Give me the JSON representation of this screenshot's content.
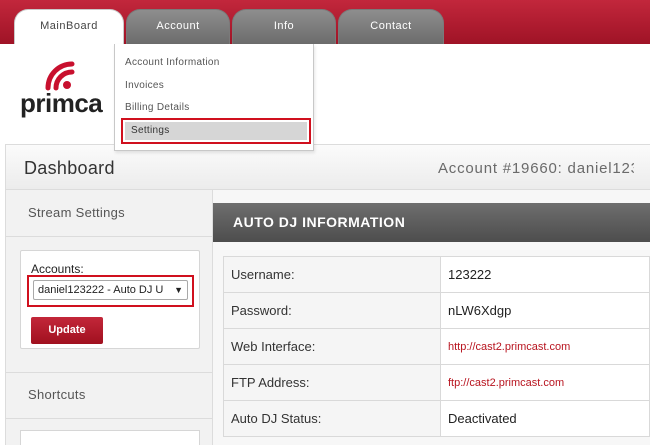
{
  "nav": {
    "tabs": [
      {
        "label": "MainBoard",
        "active": true
      },
      {
        "label": "Account",
        "active": false
      },
      {
        "label": "Info",
        "active": false
      },
      {
        "label": "Contact",
        "active": false
      }
    ]
  },
  "account_menu": {
    "items": [
      "Account Information",
      "Invoices",
      "Billing Details",
      "Settings"
    ],
    "selected": "Settings"
  },
  "logo": {
    "text": "primca"
  },
  "dashboard": {
    "title": "Dashboard",
    "account_number": "Account #19660: daniel123"
  },
  "sidebar": {
    "stream_settings_heading": "Stream Settings",
    "accounts_label": "Accounts:",
    "accounts_selected": "daniel123222 - Auto DJ U",
    "update_label": "Update",
    "shortcuts_heading": "Shortcuts"
  },
  "auto_dj": {
    "heading": "AUTO DJ INFORMATION",
    "rows": [
      {
        "label": "Username:",
        "value": "123222",
        "link": false
      },
      {
        "label": "Password:",
        "value": "nLW6Xdgp",
        "link": false
      },
      {
        "label": "Web Interface:",
        "value": "http://cast2.primcast.com",
        "link": true
      },
      {
        "label": "FTP Address:",
        "value": "ftp://cast2.primcast.com",
        "link": true
      },
      {
        "label": "Auto DJ Status:",
        "value": "Deactivated",
        "link": false
      }
    ]
  },
  "colors": {
    "brand_red": "#b01a2e",
    "highlight_red": "#d0101e",
    "tab_gray": "#7c7c7c",
    "info_bar_gray": "#5c5c5c"
  }
}
